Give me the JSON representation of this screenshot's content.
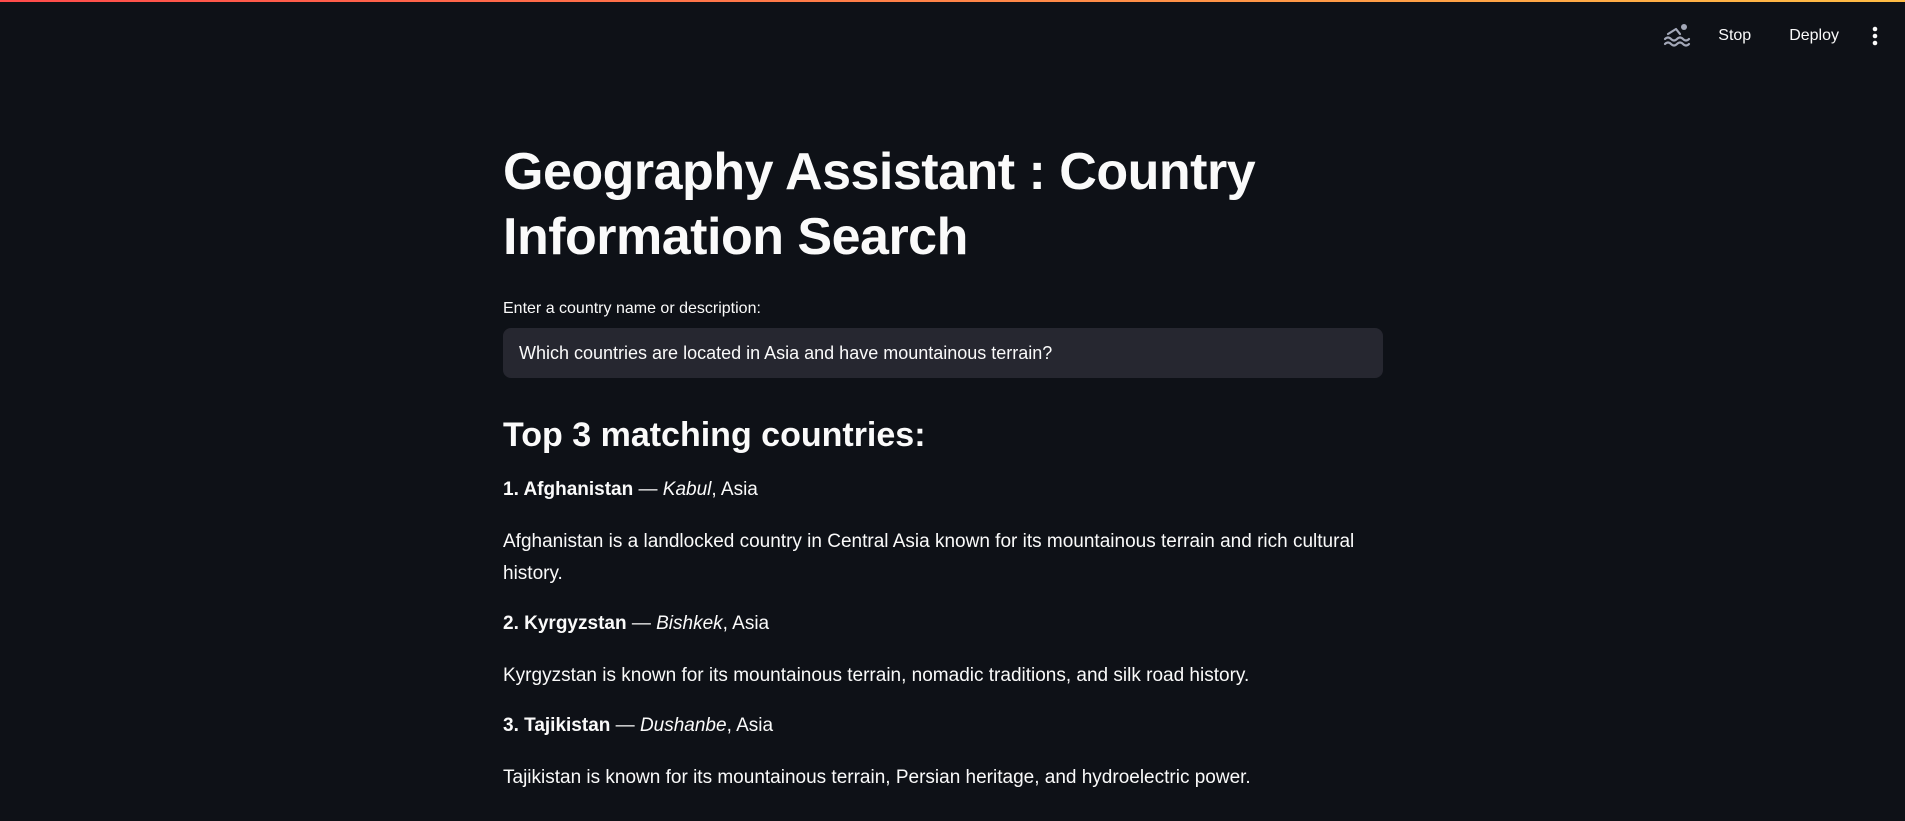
{
  "header": {
    "stop_label": "Stop",
    "deploy_label": "Deploy",
    "running_icon": "swimmer-icon",
    "menu_icon": "kebab-menu-icon"
  },
  "main": {
    "title": "Geography Assistant : Country Information Search",
    "input": {
      "label": "Enter a country name or description:",
      "value": "Which countries are located in Asia and have mountainous terrain?"
    },
    "results_heading": "Top 3 matching countries:",
    "results": [
      {
        "rank": "1.",
        "name": "Afghanistan",
        "separator": " — ",
        "capital": "Kabul",
        "region": ", Asia",
        "description": "Afghanistan is a landlocked country in Central Asia known for its mountainous terrain and rich cultural history."
      },
      {
        "rank": "2.",
        "name": "Kyrgyzstan",
        "separator": " — ",
        "capital": "Bishkek",
        "region": ", Asia",
        "description": "Kyrgyzstan is known for its mountainous terrain, nomadic traditions, and silk road history."
      },
      {
        "rank": "3.",
        "name": "Tajikistan",
        "separator": " — ",
        "capital": "Dushanbe",
        "region": ", Asia",
        "description": "Tajikistan is known for its mountainous terrain, Persian heritage, and hydroelectric power."
      }
    ]
  },
  "colors": {
    "background": "#0e1117",
    "input_bg": "#262730",
    "text": "#fafafa",
    "accent_start": "#ff4b4b",
    "accent_end": "#ffbd45"
  }
}
